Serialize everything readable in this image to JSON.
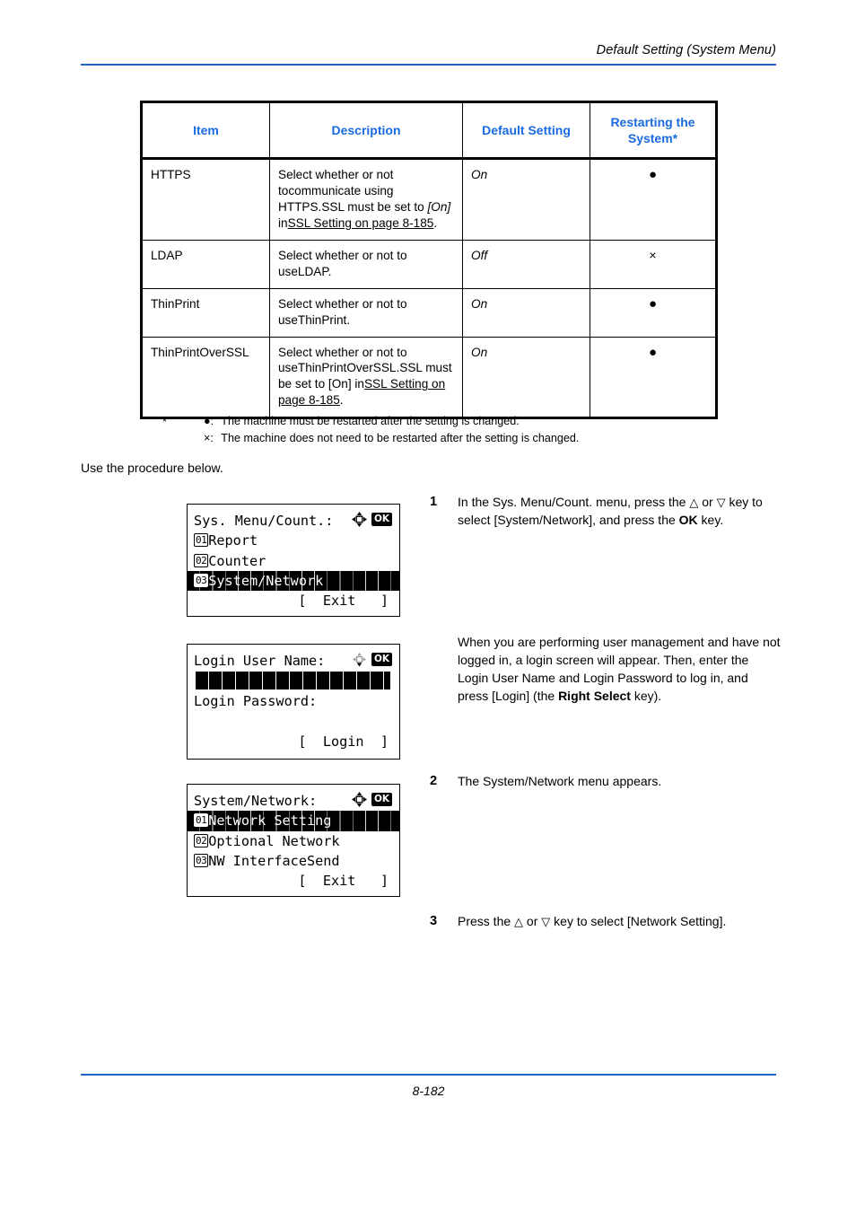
{
  "header": {
    "title": "Default Setting (System Menu)",
    "rule_color": "#1f64c8"
  },
  "table": {
    "headers": {
      "item": "Item",
      "description": "Description",
      "default_setting": "Default Setting",
      "restarting": "Restarting the System*"
    },
    "header_color": "#1a6ae0",
    "rows": [
      {
        "item": "HTTPS",
        "desc_line1": "Select whether or not to",
        "desc_line2": "communicate using HTTPS.",
        "desc_line3_pre": "SSL must be set to ",
        "desc_line3_em": "[On]",
        "desc_line3_post": " in",
        "desc_line4_link": "SSL Setting on page 8-185",
        "desc_line4_post": ".",
        "default": "On",
        "restart": "●"
      },
      {
        "item": "LDAP",
        "desc_line1": "Select whether or not to use",
        "desc_line2": "LDAP.",
        "default": "Off",
        "restart": "×"
      },
      {
        "item": "ThinPrint",
        "desc_line1": "Select whether or not to use",
        "desc_line2": "ThinPrint.",
        "default": "On",
        "restart": "●"
      },
      {
        "item": "ThinPrintOverSSL",
        "desc_line1": "Select whether or not to use",
        "desc_line2": "ThinPrintOverSSL.",
        "desc_line3": "SSL must be set to [On] in",
        "desc_line4_link": "SSL Setting on page 8-185",
        "desc_line4_post": ".",
        "default": "On",
        "restart": "●"
      }
    ]
  },
  "footnote": {
    "star": "*",
    "dot_symbol": "●:",
    "dot_text": "The machine must be restarted after the setting is changed.",
    "x_symbol": "×:",
    "x_text": "The machine does not need to be restarted after the setting is changed."
  },
  "procedure": {
    "intro": "Use the procedure below."
  },
  "panels": {
    "sys_menu": {
      "title": "Sys. Menu/Count.:",
      "ok_label": "OK",
      "items": [
        {
          "num": "01",
          "label": "Report"
        },
        {
          "num": "02",
          "label": "Counter"
        },
        {
          "num": "03",
          "label": "System/Network"
        }
      ],
      "footer": "[  Exit   ]"
    },
    "login": {
      "title": "Login User Name:",
      "ok_label": "OK",
      "password_label": "Login Password:",
      "footer": "[  Login  ]"
    },
    "system_network": {
      "title": "System/Network:",
      "ok_label": "OK",
      "items": [
        {
          "num": "01",
          "label": "Network Setting"
        },
        {
          "num": "02",
          "label": "Optional Network"
        },
        {
          "num": "03",
          "label": "NW InterfaceSend"
        }
      ],
      "footer": "[  Exit   ]"
    }
  },
  "steps": {
    "step1": {
      "number": "1",
      "t1": "In the Sys. Menu/Count. menu, press the ",
      "up": "△",
      "t2": " or ",
      "down": "▽",
      "t3": " key to select [System/Network], and press the ",
      "ok": "OK",
      "t4": " key."
    },
    "note": {
      "t1": "When you are performing user management and have not logged in, a login screen will appear. Then, enter the Login User Name and Login Password to log in, and press [Login] (the ",
      "bold": "Right Select",
      "t2": " key)."
    },
    "step2": {
      "number": "2",
      "text": "The System/Network menu appears."
    },
    "step3": {
      "number": "3",
      "t1": "Press the ",
      "up": "△",
      "t2": " or ",
      "down": "▽",
      "t3": " key to select [Network Setting]."
    }
  },
  "footer": {
    "page_number": "8-182",
    "rule_color": "#1f64c8"
  }
}
